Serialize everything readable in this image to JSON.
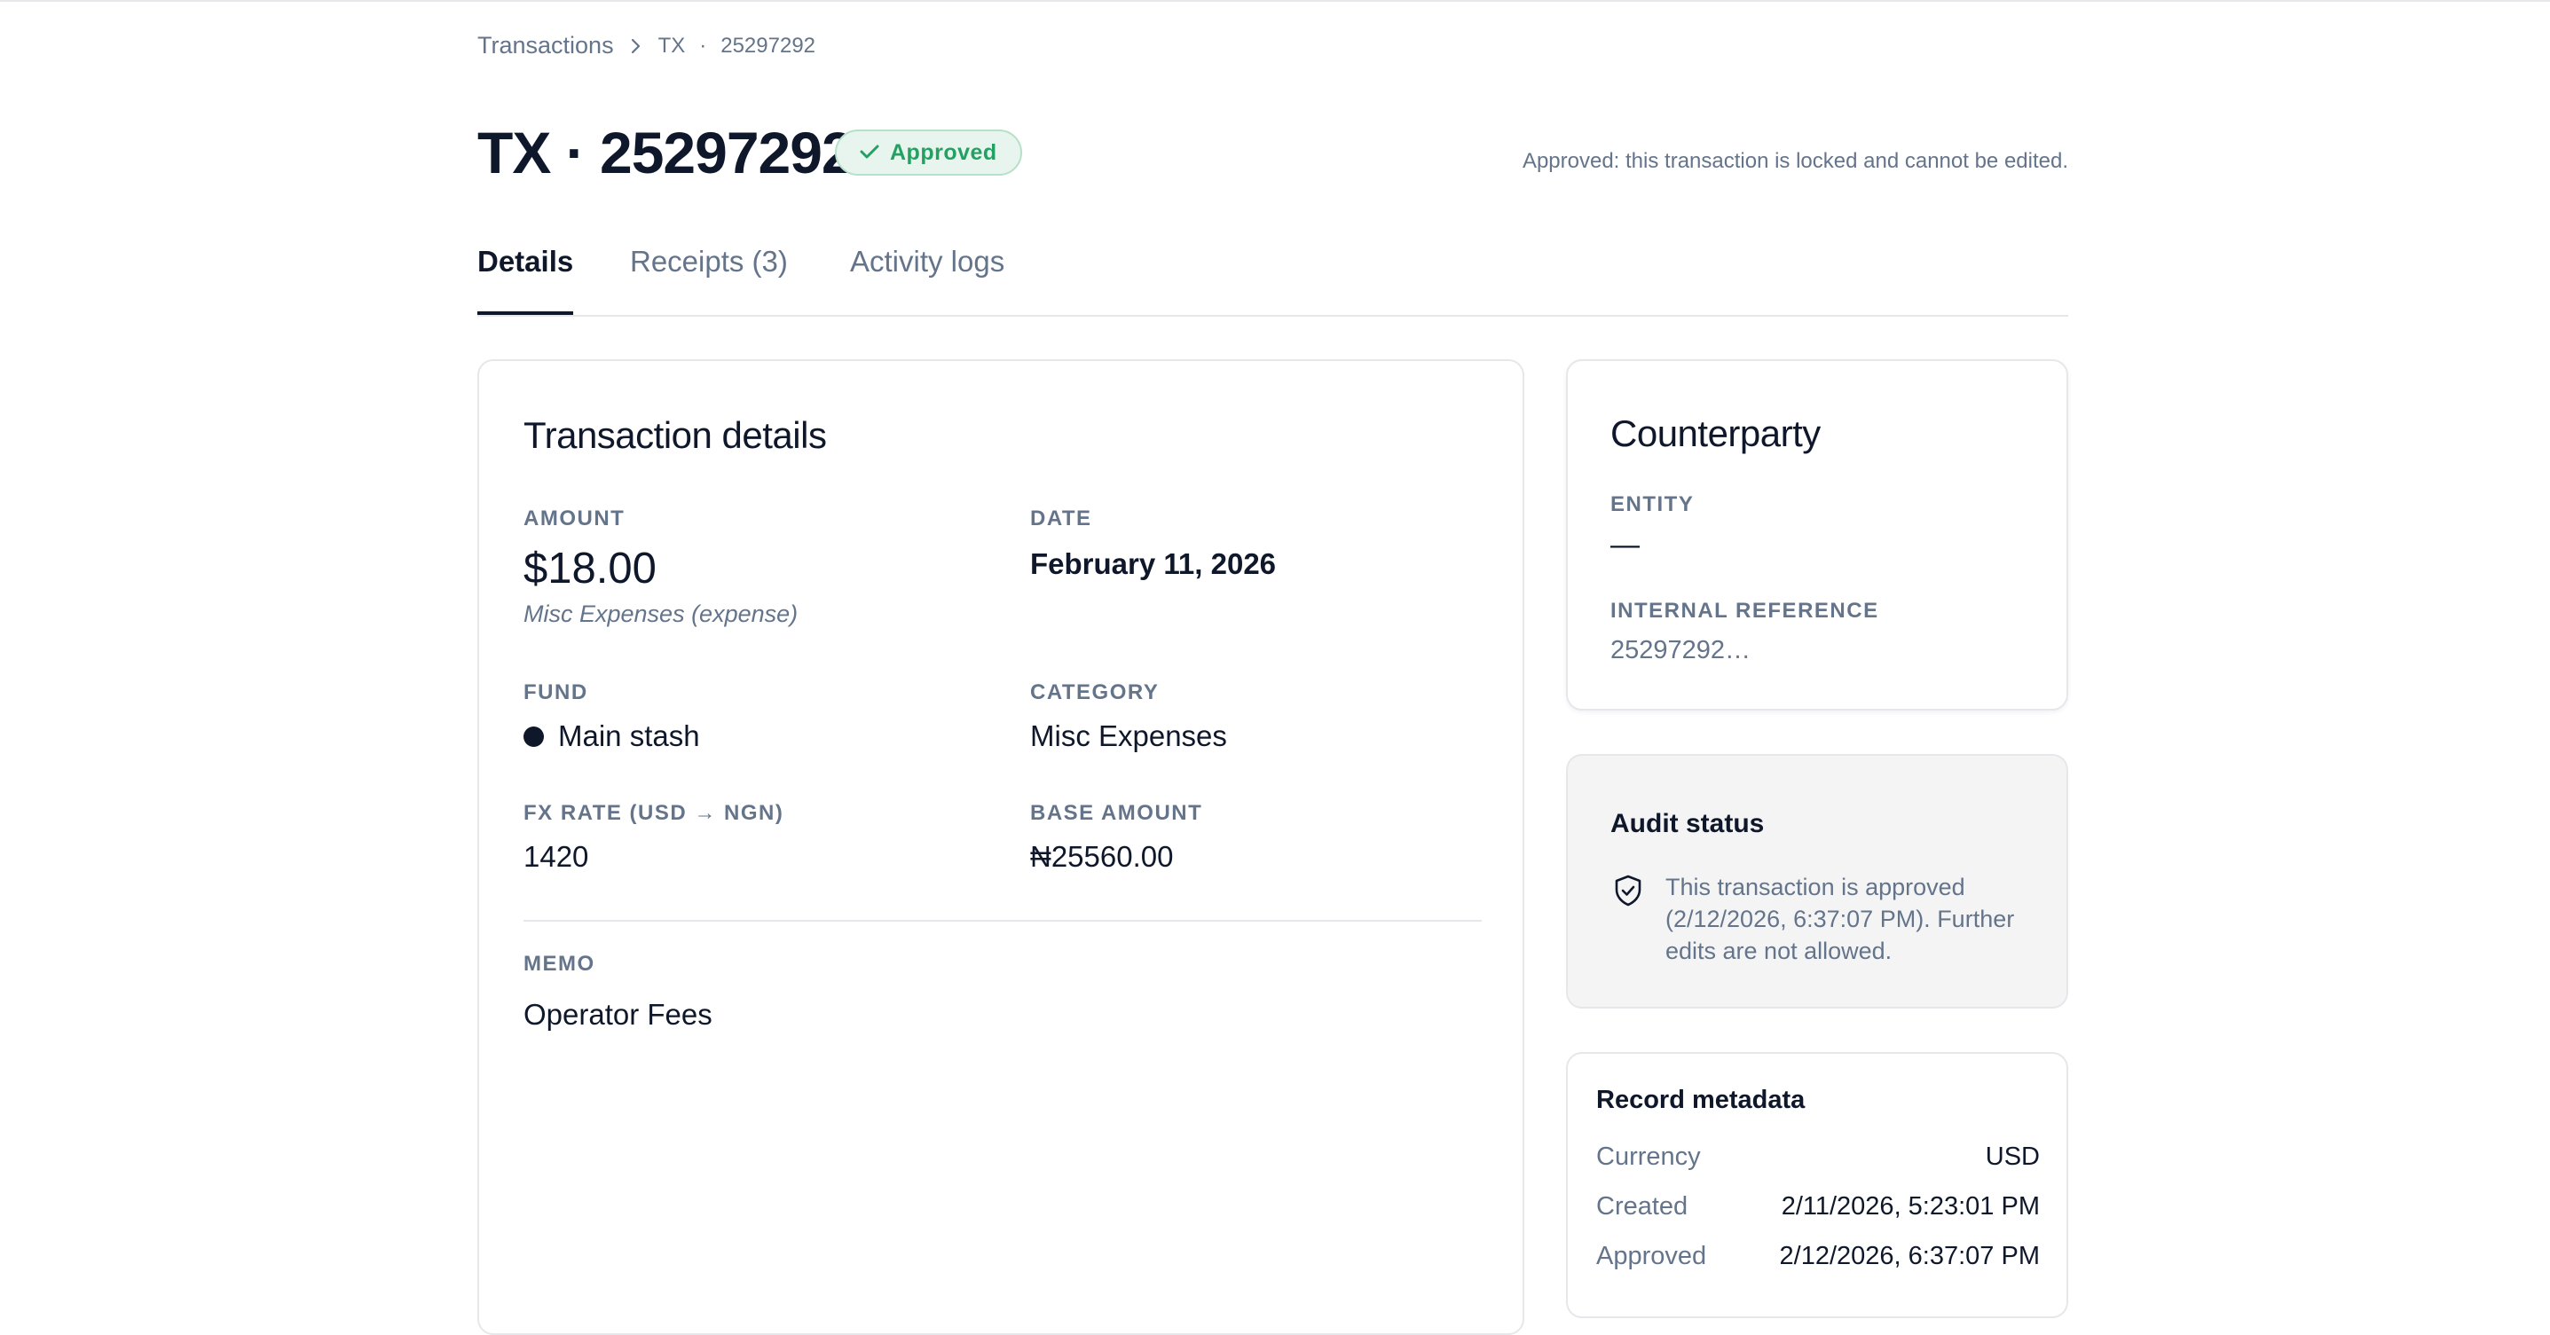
{
  "breadcrumb": {
    "root": "Transactions",
    "prefix": "TX",
    "dot": "·",
    "id": "25297292"
  },
  "header": {
    "title": "TX · 25297292",
    "status_badge": "Approved",
    "status_color": "#22a163",
    "lock_note": "Approved: this transaction is locked and cannot be edited."
  },
  "tabs": [
    {
      "label": "Details",
      "active": true
    },
    {
      "label": "Receipts (3)",
      "active": false
    },
    {
      "label": "Activity logs",
      "active": false
    }
  ],
  "transaction": {
    "card_title": "Transaction details",
    "amount_label": "AMOUNT",
    "amount": "$18.00",
    "amount_sub": "Misc Expenses (expense)",
    "date_label": "DATE",
    "date": "February 11, 2026",
    "fund_label": "FUND",
    "fund": "Main stash",
    "category_label": "CATEGORY",
    "category": "Misc Expenses",
    "fx_label": "FX RATE (USD → NGN)",
    "fx": "1420",
    "base_label": "BASE AMOUNT",
    "base": "₦25560.00",
    "memo_label": "MEMO",
    "memo": "Operator Fees"
  },
  "counterparty": {
    "card_title": "Counterparty",
    "entity_label": "ENTITY",
    "entity": "—",
    "ref_label": "INTERNAL REFERENCE",
    "ref": "25297292…"
  },
  "audit": {
    "title": "Audit status",
    "text": "This transaction is approved (2/12/2026, 6:37:07 PM). Further edits are not allowed.",
    "icon": "shield-check-icon"
  },
  "metadata": {
    "title": "Record metadata",
    "rows": [
      {
        "key": "Currency",
        "value": "USD"
      },
      {
        "key": "Created",
        "value": "2/11/2026, 5:23:01 PM"
      },
      {
        "key": "Approved",
        "value": "2/12/2026, 6:37:07 PM"
      }
    ]
  }
}
